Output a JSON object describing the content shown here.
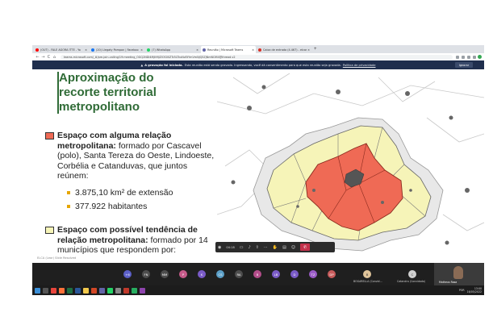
{
  "browser": {
    "tabs": [
      {
        "label": "(OUT) - FALE AGORA ITTE - Yo",
        "color": "#ff0000"
      },
      {
        "label": "(20) Llegaty Pompon | Faceboo",
        "color": "#1877f2"
      },
      {
        "label": "(7) WhatsApp",
        "color": "#25d366"
      },
      {
        "label": "Reunião | Microsoft Teams",
        "color": "#6264a7"
      },
      {
        "label": "Caixa de entrada (4.467) - elcar",
        "color": "#d93025"
      }
    ],
    "new_tab": "+",
    "address": "teams.microsoft.com/_#/pre-join-calling/19:meeting_OGQ2NDI4MjItMjZlOS00ZTc5LTkxNzEtYmVmNjQ5ZjNmNGM4@thread.v2",
    "nav": {
      "back": "←",
      "forward": "→",
      "reload": "C",
      "home": "⌂"
    }
  },
  "notification": {
    "bold": "A gravação foi iniciada.",
    "text": "Esta reunião está sendo gravada. Ingressando, você dá consentimento para que esta reunião seja gravada.",
    "link": "Política de privacidade",
    "ignore": "Ignorar"
  },
  "slide": {
    "title_lines": [
      "Aproximação do",
      "recorte territorial",
      "metropolitano"
    ],
    "legend_red": {
      "bold": "Espaço com alguma relação metropolitana:",
      "text": " formado por Cascavel (polo), Santa Tereza do Oeste, Lindoeste, Corbélia e Catanduvas, que juntos reúnem:"
    },
    "bullets": [
      "3.875,10 km² de extensão",
      "377.922 habitantes"
    ],
    "legend_yellow": {
      "bold": "Espaço com possível tendência de relação metropolitana:",
      "text": " formado por 14 municípios que respondem por:"
    },
    "caption": "ELCA (Lear) Slide Resolved",
    "colors": {
      "red": "#ef6a55",
      "yellow": "#f6f4b8",
      "title": "#2f6b36",
      "bullet": "#e6a600"
    }
  },
  "meeting_toolbar": {
    "time": "04:18",
    "leave_icon": "✆"
  },
  "participants": [
    {
      "initials": "+6",
      "color": "#5b5fc7"
    },
    {
      "initials": "FN",
      "color": "#4d4d4d"
    },
    {
      "initials": "MM",
      "color": "#4d4d4d"
    },
    {
      "initials": "P",
      "color": "#c75b8a"
    },
    {
      "initials": "K",
      "color": "#7a5bc7"
    },
    {
      "initials": "CS",
      "color": "#5b9fc7"
    },
    {
      "initials": "RA",
      "color": "#4d4d4d"
    },
    {
      "initials": "B",
      "color": "#b34d8a"
    },
    {
      "initials": "LB",
      "color": "#7a5bc7"
    },
    {
      "initials": "D",
      "color": "#7a5bc7"
    },
    {
      "initials": "TZ",
      "color": "#9a5bc7"
    },
    {
      "initials": "DP",
      "color": "#c75b5b"
    },
    {
      "initials": "B",
      "color": "#e0c49a"
    },
    {
      "initials": "C",
      "color": "#cfcfcf"
    }
  ],
  "participant_names": {
    "bogarella": "BOGARELLA (Convid...",
    "catandra": "Catandra (Convidado)",
    "video": "Matheus Rosa"
  },
  "taskbar": {
    "time": "13:00",
    "date": "16/05/2022",
    "lang": "POR"
  }
}
